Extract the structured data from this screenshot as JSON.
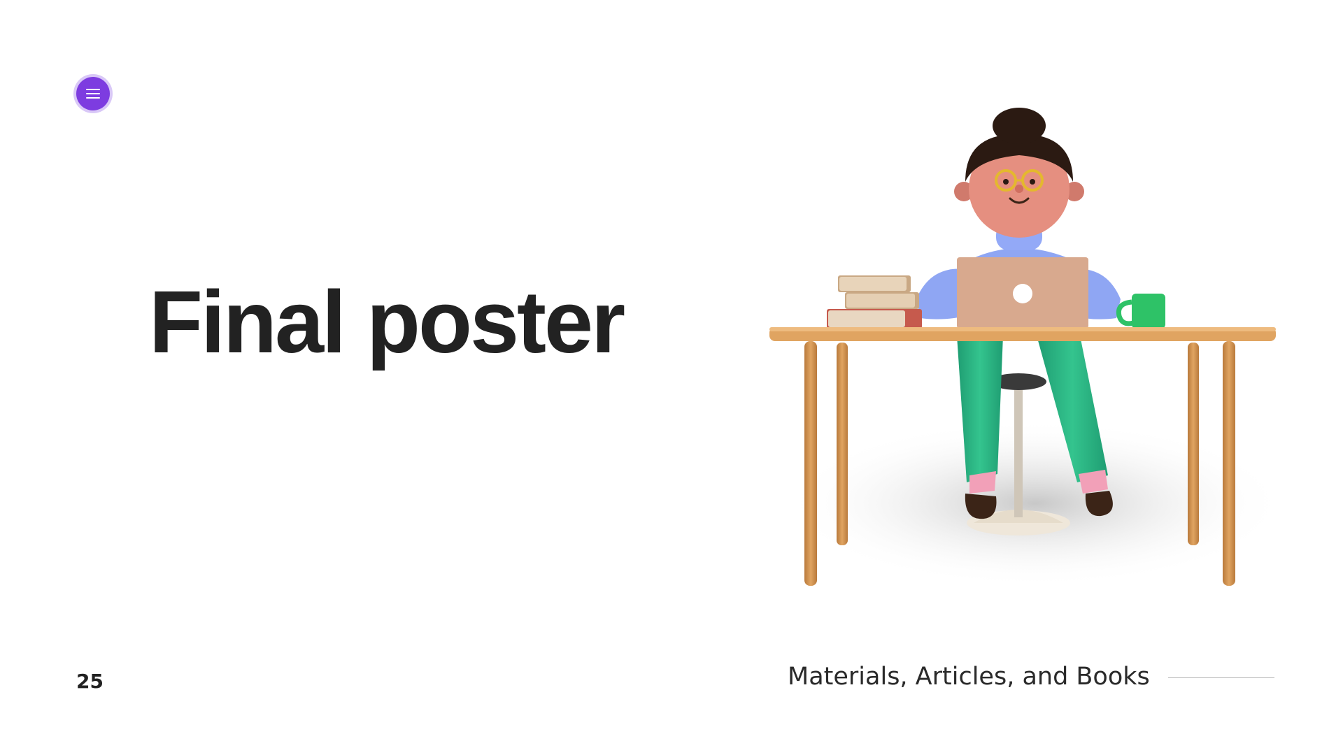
{
  "slide": {
    "title": "Final poster",
    "page_number": "25",
    "footer_caption": "Materials, Articles, and Books"
  },
  "menu": {
    "icon": "hamburger-menu-icon",
    "color": "#7d3ce0"
  },
  "illustration": {
    "subject": "person-working-at-desk-illustration"
  },
  "colors": {
    "title": "#222222",
    "accent": "#7d3ce0",
    "background": "#ffffff"
  }
}
